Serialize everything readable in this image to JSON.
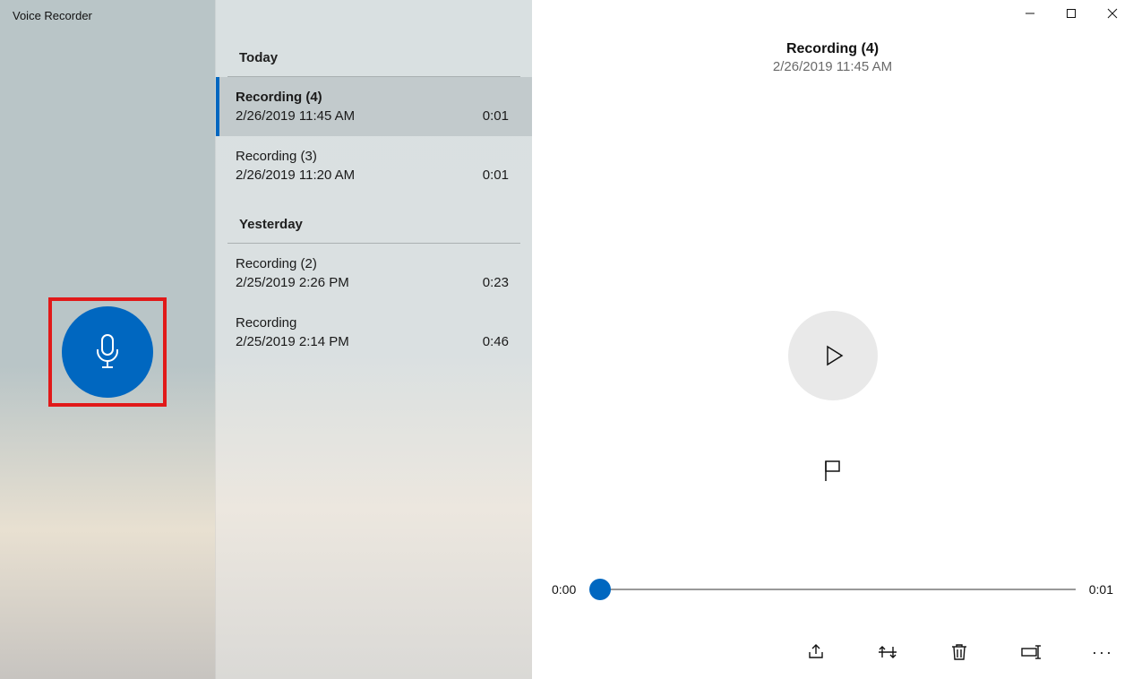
{
  "app": {
    "title": "Voice Recorder"
  },
  "list": {
    "groups": [
      {
        "header": "Today",
        "items": [
          {
            "name": "Recording (4)",
            "timestamp": "2/26/2019 11:45 AM",
            "duration": "0:01",
            "selected": true
          },
          {
            "name": "Recording (3)",
            "timestamp": "2/26/2019 11:20 AM",
            "duration": "0:01",
            "selected": false
          }
        ]
      },
      {
        "header": "Yesterday",
        "items": [
          {
            "name": "Recording (2)",
            "timestamp": "2/25/2019 2:26 PM",
            "duration": "0:23",
            "selected": false
          },
          {
            "name": "Recording",
            "timestamp": "2/25/2019 2:14 PM",
            "duration": "0:46",
            "selected": false
          }
        ]
      }
    ]
  },
  "detail": {
    "title": "Recording (4)",
    "timestamp": "2/26/2019 11:45 AM",
    "progress": {
      "current": "0:00",
      "total": "0:01"
    }
  },
  "icons": {
    "record": "microphone-icon",
    "play": "play-icon",
    "flag": "flag-icon",
    "share": "share-icon",
    "trim": "trim-icon",
    "delete": "trash-icon",
    "rename": "rename-icon",
    "more": "more-icon",
    "minimize": "minimize-icon",
    "maximize": "maximize-icon",
    "close": "close-icon"
  },
  "colors": {
    "accent": "#0067c0",
    "highlight": "#e11919"
  }
}
